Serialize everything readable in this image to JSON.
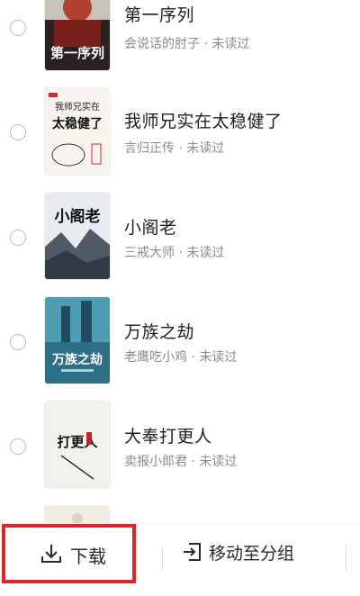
{
  "books": [
    {
      "title": "第一序列",
      "author": "会说话的肘子",
      "status": "未读过",
      "cover_text": "第一序列"
    },
    {
      "title": "我师兄实在太稳健了",
      "author": "言归正传",
      "status": "未读过",
      "cover_text_top": "我师兄实在",
      "cover_text_bottom": "太稳健了"
    },
    {
      "title": "小阁老",
      "author": "三戒大师",
      "status": "未读过",
      "cover_text": "小阁老"
    },
    {
      "title": "万族之劫",
      "author": "老鹰吃小鸡",
      "status": "未读过",
      "cover_text": "万族之劫"
    },
    {
      "title": "大奉打更人",
      "author": "卖报小郎君",
      "status": "未读过",
      "cover_text": "打更人"
    }
  ],
  "separator": " · ",
  "toolbar": {
    "download_label": "下载",
    "move_label": "移动至分组"
  },
  "colors": {
    "highlight": "#d8282e",
    "meta_text": "#8a8a8a"
  }
}
